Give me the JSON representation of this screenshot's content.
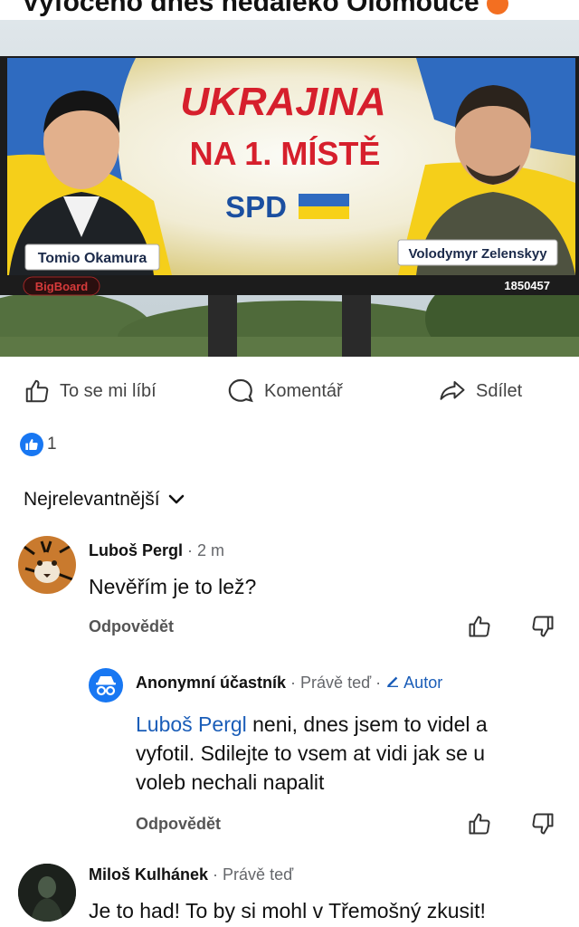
{
  "header": {
    "title": "Vyfoceno dnes nedaleko Olomouce"
  },
  "billboard": {
    "headline_1": "UKRAJINA",
    "headline_2": "NA 1. MÍSTĚ",
    "party": "SPD",
    "left_caption": "Tomio Okamura",
    "right_caption": "Volodymyr Zelenskyy",
    "brand": "BigBoard",
    "code": "1850457"
  },
  "actions": {
    "like_label": "To se mi líbí",
    "comment_label": "Komentář",
    "share_label": "Sdílet"
  },
  "reactions": {
    "count": "1"
  },
  "sort": {
    "label": "Nejrelevantnější"
  },
  "comments": [
    {
      "name": "Luboš Pergl",
      "time": "· 2 m",
      "text": "Nevěřím je to lež?",
      "reply_label": "Odpovědět"
    },
    {
      "name": "Anonymní účastník",
      "time": "· Právě teď ·",
      "badge": "Autor",
      "mention": "Luboš Pergl",
      "text_line1": " neni, dnes jsem to videl a",
      "text_line2": "vyfotil. Sdilejte to vsem at vidi jak se u",
      "text_line3": "voleb nechali napalit",
      "reply_label": "Odpovědět"
    },
    {
      "name": "Miloš Kulhánek",
      "time": "· Právě teď",
      "text": "Je to had! To by si mohl v Třemošný zkusit!"
    }
  ],
  "colors": {
    "accent": "#1877f2",
    "mention": "#1a5db8",
    "billboard_red": "#d61f2c",
    "billboard_blue": "#1b4fa0",
    "ukraine_yellow": "#f7d117"
  }
}
